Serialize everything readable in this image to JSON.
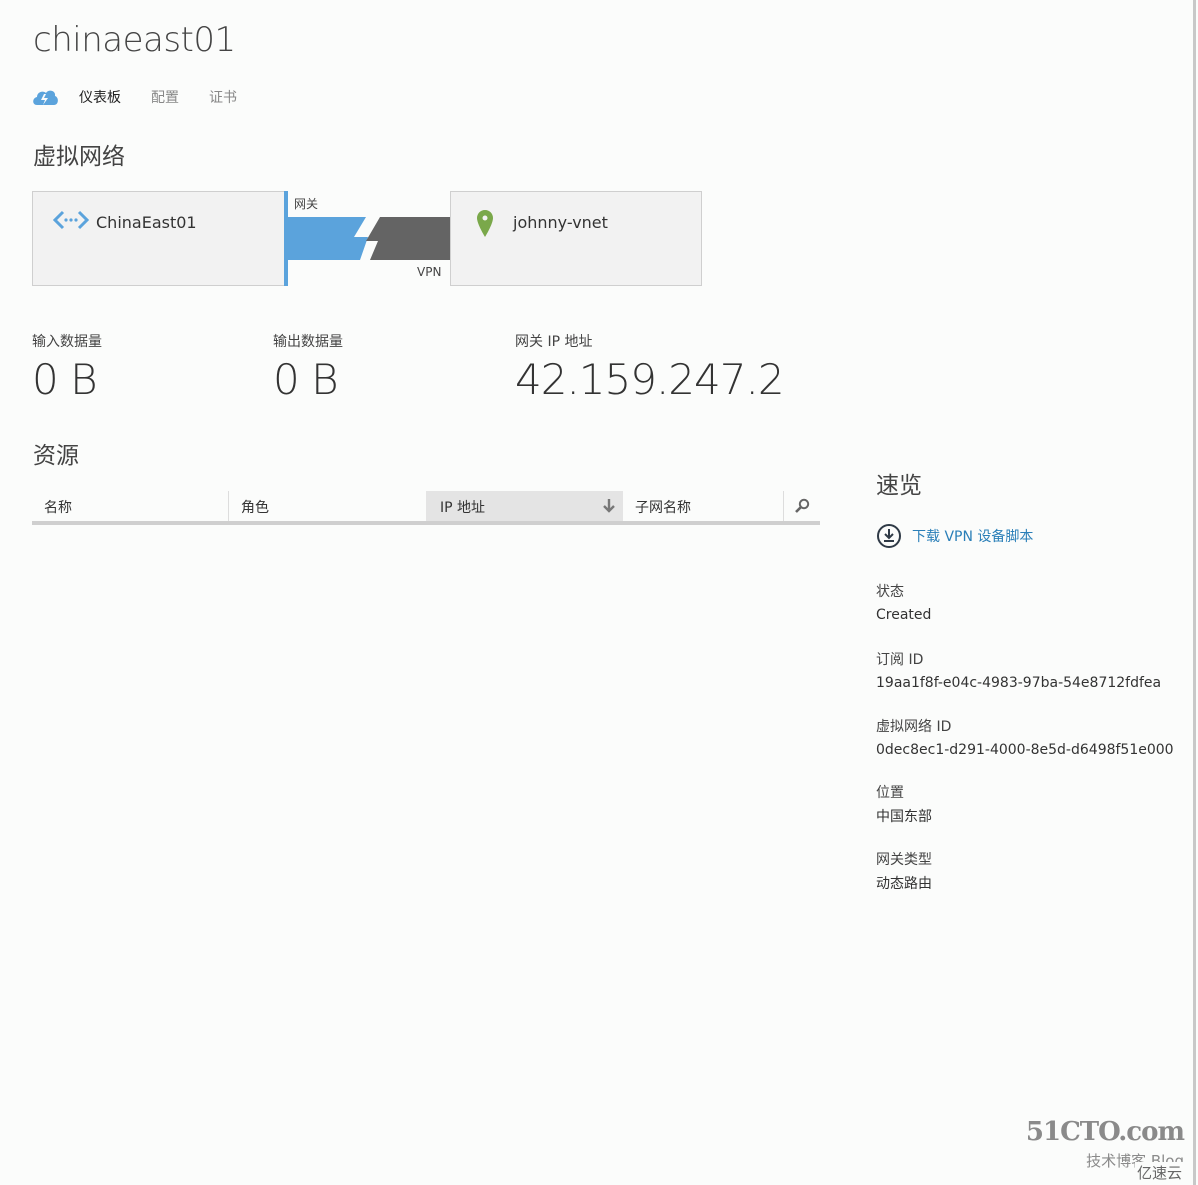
{
  "page": {
    "title": "chinaeast01"
  },
  "tabs": [
    {
      "label": "仪表板",
      "active": true
    },
    {
      "label": "配置",
      "active": false
    },
    {
      "label": "证书",
      "active": false
    }
  ],
  "network": {
    "section_title": "虚拟网络",
    "local": {
      "name": "ChinaEast01",
      "icon": "virtual-network-icon"
    },
    "gateway_label": "网关",
    "connection_type": "VPN",
    "remote": {
      "name": "johnny-vnet",
      "icon": "location-pin-icon"
    },
    "colors": {
      "gateway": "#5ba3dc",
      "connection": "#646464",
      "pin": "#7aa84a",
      "network_icon": "#5ba3dc"
    }
  },
  "metrics": [
    {
      "label": "输入数据量",
      "value": "0 B"
    },
    {
      "label": "输出数据量",
      "value": "0 B"
    },
    {
      "label": "网关 IP 地址",
      "value": "42.159.247.2"
    }
  ],
  "resources": {
    "section_title": "资源",
    "columns": [
      {
        "label": "名称",
        "sorted": false
      },
      {
        "label": "角色",
        "sorted": false
      },
      {
        "label": "IP 地址",
        "sorted": true,
        "sort_direction": "descending"
      },
      {
        "label": "子网名称",
        "sorted": false
      }
    ],
    "rows": []
  },
  "quick_glance": {
    "title": "速览",
    "download_link": "下载 VPN 设备脚本",
    "fields": [
      {
        "label": "状态",
        "value": "Created"
      },
      {
        "label": "订阅 ID",
        "value": "19aa1f8f-e04c-4983-97ba-54e8712fdfea"
      },
      {
        "label": "虚拟网络 ID",
        "value": "0dec8ec1-d291-4000-8e5d-d6498f51e000"
      },
      {
        "label": "位置",
        "value": "中国东部"
      },
      {
        "label": "网关类型",
        "value": "动态路由"
      }
    ],
    "link_color": "#2a7fb8"
  },
  "watermark": {
    "line1": "51CTO.com",
    "line2": "技术博客 Blog",
    "line3": "亿速云"
  }
}
